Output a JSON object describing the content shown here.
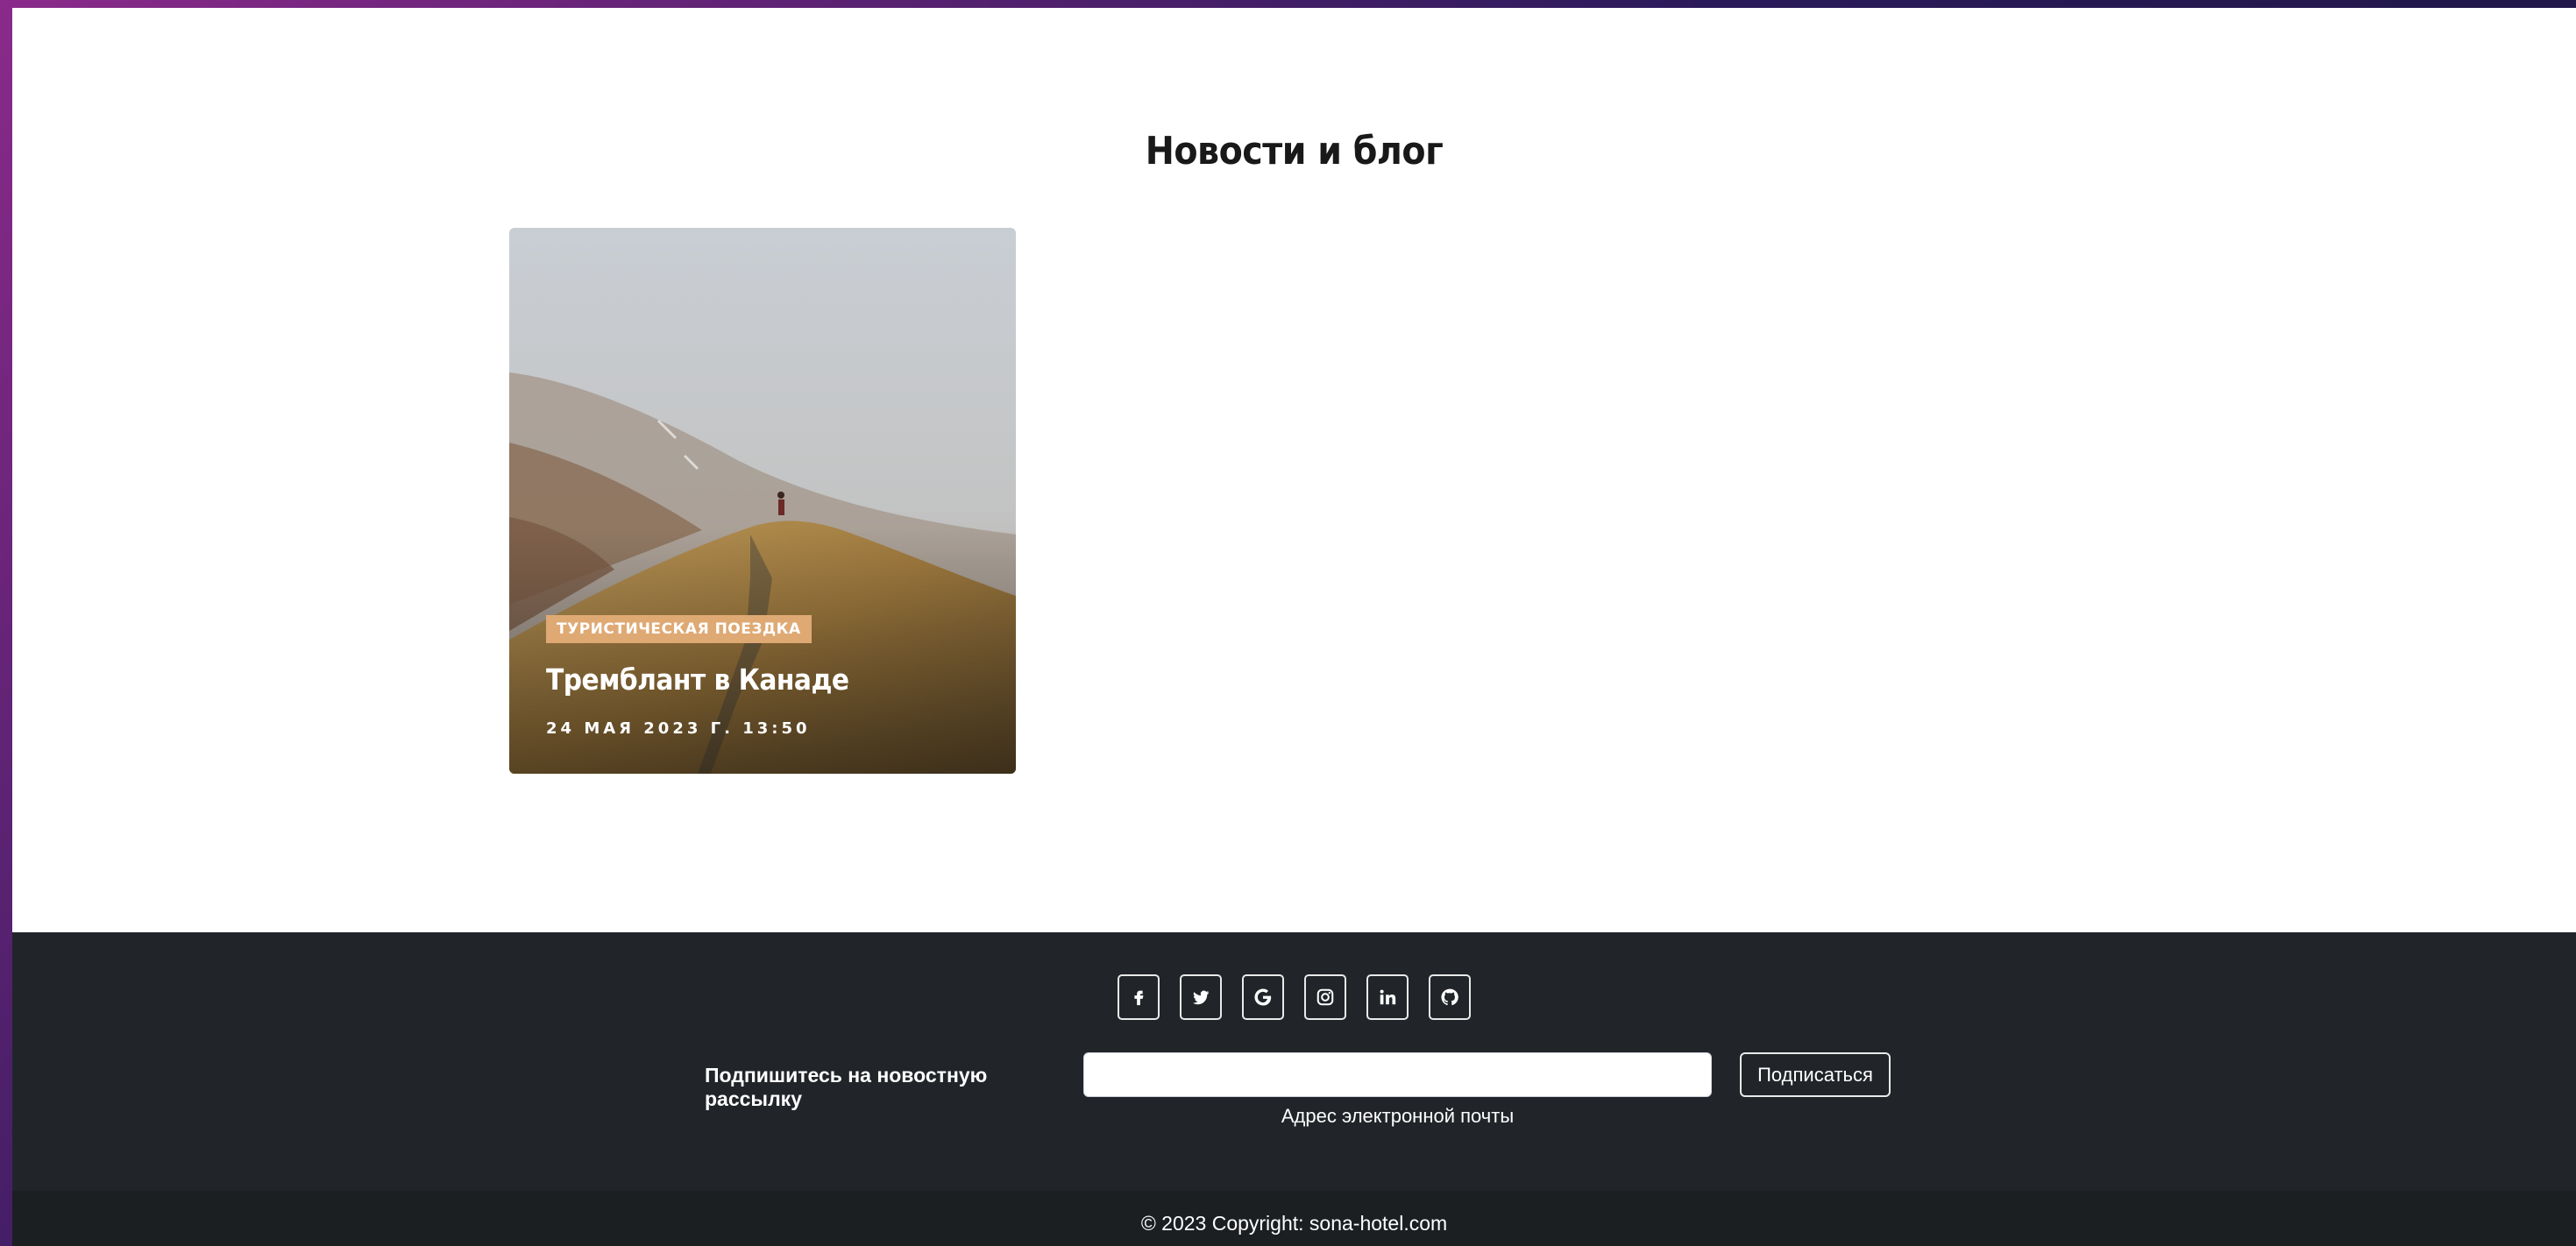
{
  "blog": {
    "title": "Новости и блог",
    "card": {
      "tag": "ТУРИСТИЧЕСКАЯ ПОЕЗДКА",
      "title": "Тремблант в Канаде",
      "date": "24 МАЯ 2023 Г. 13:50"
    }
  },
  "footer": {
    "social": [
      {
        "name": "facebook",
        "icon": "facebook-icon"
      },
      {
        "name": "twitter",
        "icon": "twitter-icon"
      },
      {
        "name": "google",
        "icon": "google-icon"
      },
      {
        "name": "instagram",
        "icon": "instagram-icon"
      },
      {
        "name": "linkedin",
        "icon": "linkedin-icon"
      },
      {
        "name": "github",
        "icon": "github-icon"
      }
    ],
    "subscribe_label": "Подпишитесь на новостную рассылку",
    "email_value": "",
    "email_help": "Адрес электронной почты",
    "subscribe_button": "Подписаться"
  },
  "copyright": "© 2023 Copyright: sona-hotel.com",
  "colors": {
    "accent": "#dfa974",
    "footer_bg": "#212529",
    "copyright_bg": "#1c1f22",
    "title": "#19191a"
  }
}
